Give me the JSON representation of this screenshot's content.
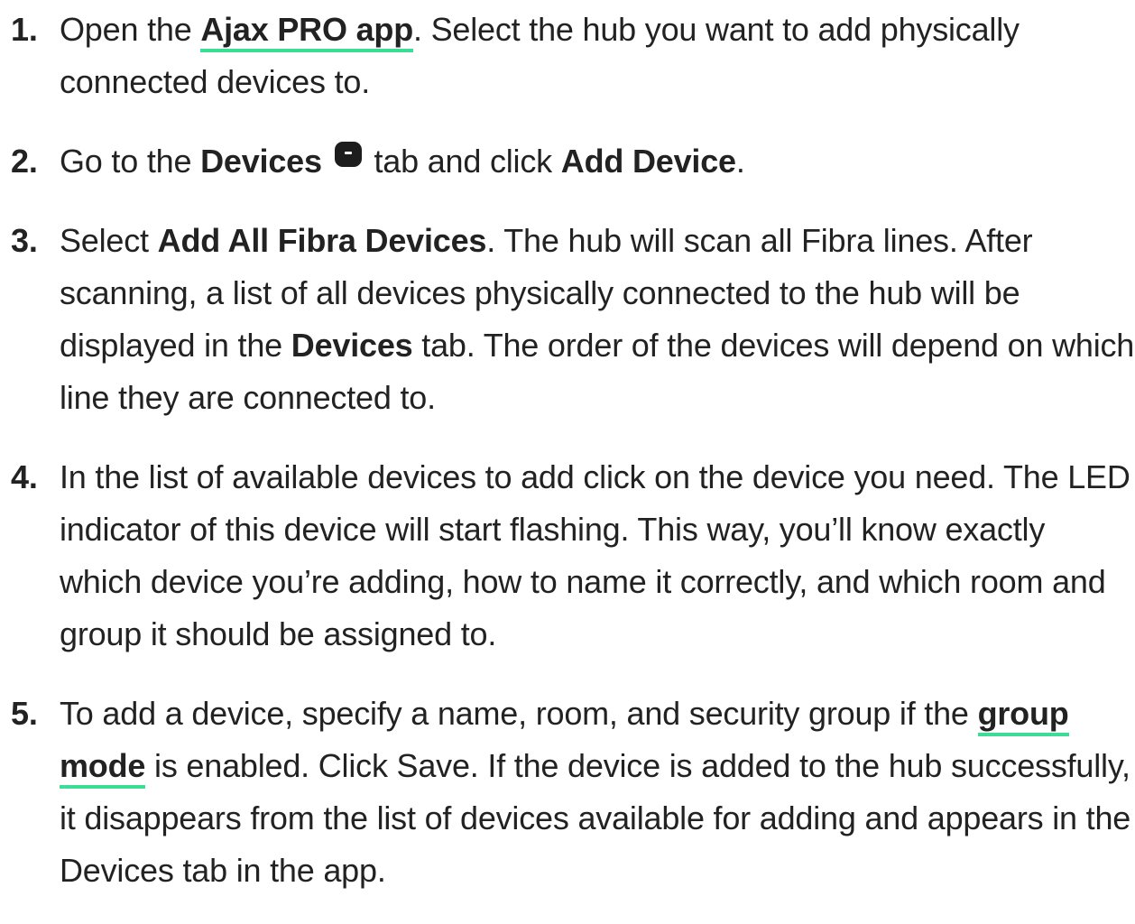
{
  "steps": [
    {
      "number": "1",
      "t1": "Open the ",
      "link": "Ajax PRO app",
      "t2": ". Select the hub you want to add physically connected devices to."
    },
    {
      "number": "2",
      "t1": "Go to the ",
      "b1": "Devices",
      "icon": "devices-tab-icon",
      "t2": " tab and click ",
      "b2": "Add Device",
      "t3": "."
    },
    {
      "number": "3",
      "t1": "Select ",
      "b1": "Add All Fibra Devices",
      "t2": ". The hub will scan all Fibra lines. After scanning, a list of all devices physically connected to the hub will be displayed in the ",
      "b2": "Devices",
      "t3": " tab. The order of the devices will depend on which line they are connected to."
    },
    {
      "number": "4",
      "t1": "In the list of available devices to add click on the device you need. The LED indicator of this device will start flashing. This way, you’ll know exactly which device you’re adding, how to name it correctly, and which room and group it should be assigned to."
    },
    {
      "number": "5",
      "t1": "To add a device, specify a name, room, and security group if the ",
      "link": "group mode",
      "t2": " is enabled. Click Save. If the device is added to the hub successfully, it disappears from the list of devices available for adding and appears in the Devices tab in the app."
    }
  ],
  "colors": {
    "text": "#222222",
    "link_underline": "#3ddc97",
    "icon_bg": "#1d1d1d"
  }
}
